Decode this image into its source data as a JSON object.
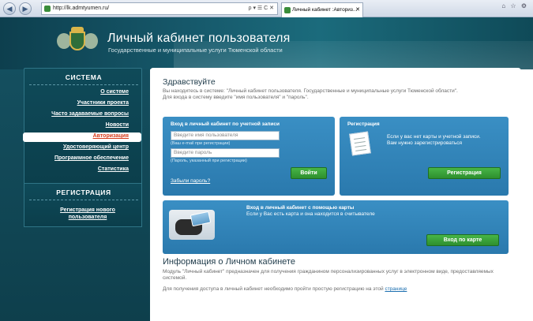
{
  "browser": {
    "url": "http://lk.admtyumen.ru/",
    "address_tools": "ρ ▾ ☰ C ✕",
    "tab_title": "Личный кабинет :Авториз...",
    "tab_close": "✕"
  },
  "header": {
    "title": "Личный кабинет пользователя",
    "subtitle": "Государственные и муниципальные услуги Тюменской области"
  },
  "sidebar": {
    "system_heading": "СИСТЕМА",
    "items": [
      {
        "label": "О системе"
      },
      {
        "label": "Участники проекта"
      },
      {
        "label": "Часто задаваемые вопросы"
      },
      {
        "label": "Новости"
      },
      {
        "label": "Авторизация",
        "active": true
      },
      {
        "label": "Удостоверяющий центр"
      },
      {
        "label": "Программное обеспечение"
      },
      {
        "label": "Статистика"
      }
    ],
    "registration_heading": "РЕГИСТРАЦИЯ",
    "registration_link": "Регистрация нового пользователя"
  },
  "main": {
    "greeting": "Здравствуйте",
    "intro_line1": "Вы находитесь в системе: \"Личный кабинет пользователя. Государственные и муниципальные услуги Тюменской области\".",
    "intro_line2": "Для входа в систему введите \"имя пользователя\" и \"пароль\".",
    "login_panel": {
      "heading": "Вход в личный кабинет по учетной записи",
      "username_placeholder": "Введите имя пользователя",
      "username_hint": "(Ваш e-mail при регистрации)",
      "password_placeholder": "Введите пароль",
      "password_hint": "(Пароль, указанный при регистрации)",
      "login_button": "Войти",
      "forgot_link": "Забыли пароль?"
    },
    "register_panel": {
      "heading": "Регистрация",
      "text": "Если у вас нет карты и учетной записи. Вам нужно зарегистрироваться",
      "button": "Регистрация"
    },
    "card_panel": {
      "heading": "Вход в личный кабинет с помощью карты",
      "text": "Если у Вас есть карта и она находится в считывателе",
      "button": "Вход по карте"
    },
    "info": {
      "title": "Информация о Личном кабинете",
      "p1": "Модуль \"Личный кабинет\" предназначен для получения гражданином персонализированных услуг в электронном виде, предоставляемых системой.",
      "p2": "Для получения доступа в личный кабинет необходимо пройти простую регистрацию на этой",
      "p2_link": "странице"
    }
  },
  "colors": {
    "header": "#16586a",
    "panel": "#3a8fc4",
    "button": "#3aa43a",
    "active_menu_text": "#d63b1a"
  }
}
